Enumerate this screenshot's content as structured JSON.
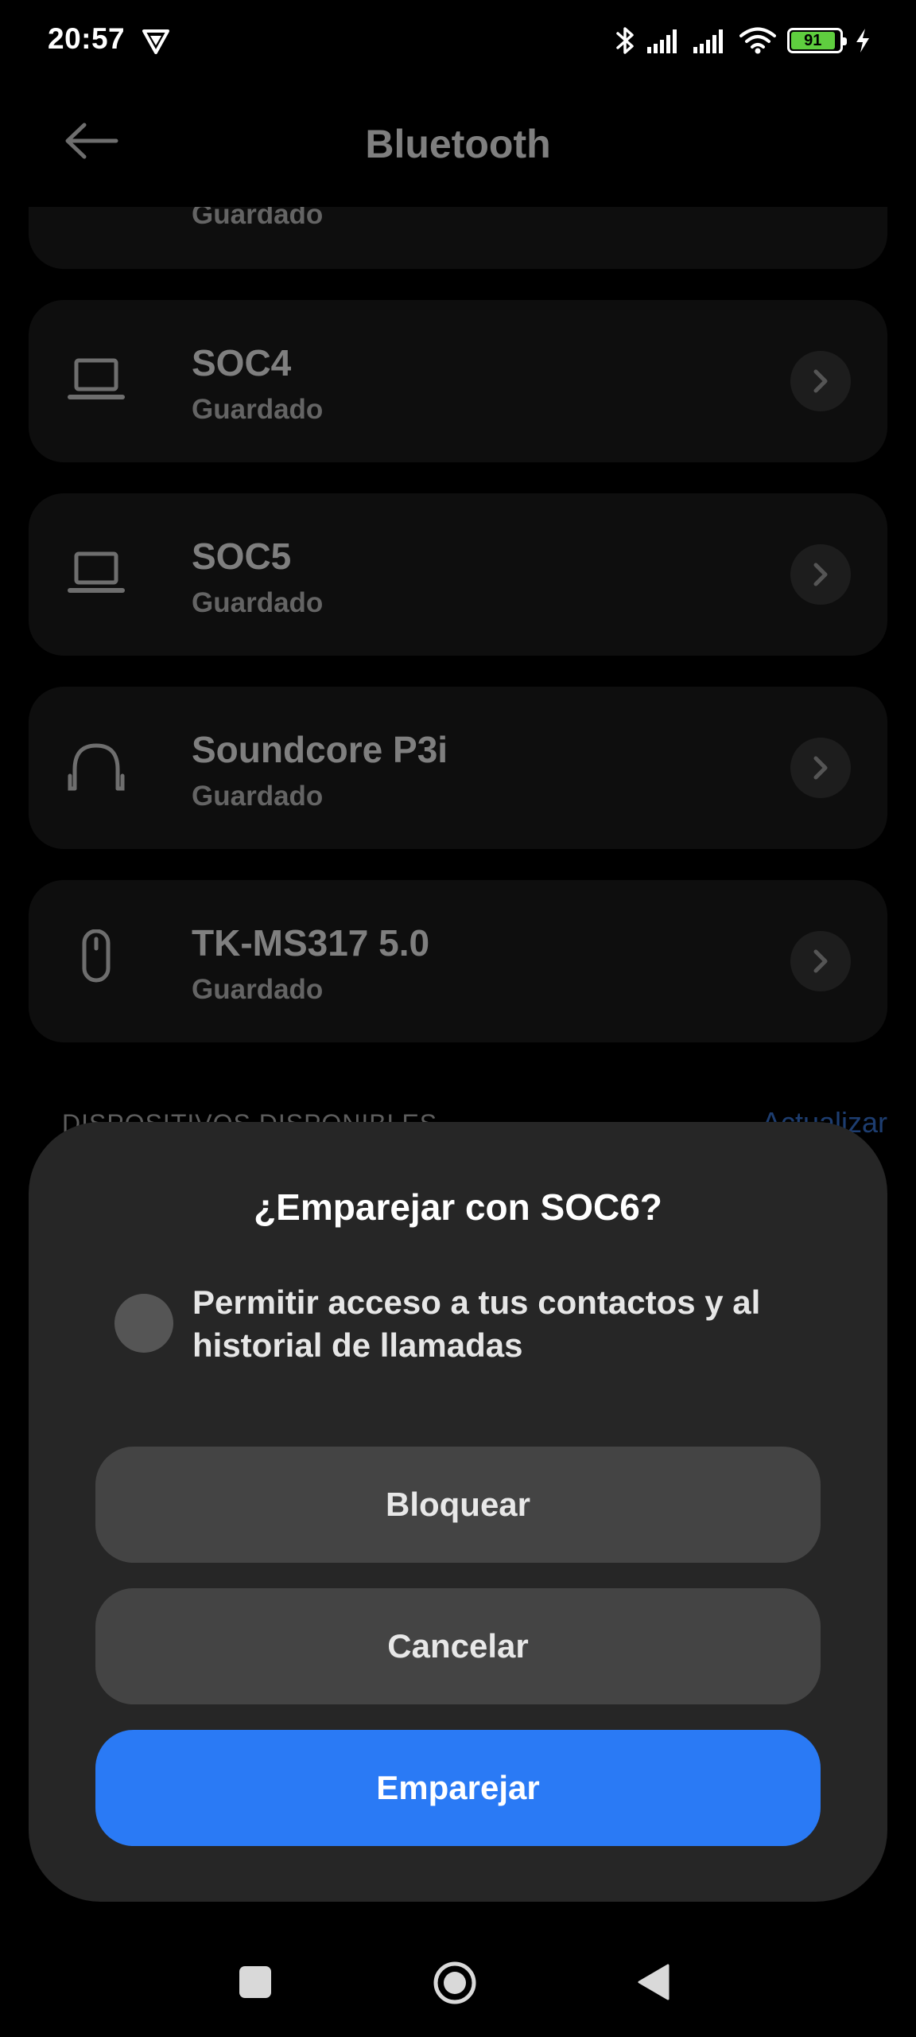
{
  "status_bar": {
    "time": "20:57",
    "battery_level": "91",
    "icons": [
      "vpn-icon",
      "bluetooth-icon",
      "signal-icon",
      "signal-icon",
      "wifi-icon",
      "battery-icon",
      "charging-icon"
    ]
  },
  "header": {
    "title": "Bluetooth",
    "back_icon": "arrow-left-icon"
  },
  "devices": [
    {
      "name": "",
      "status": "Guardado",
      "icon": "laptop-icon"
    },
    {
      "name": "SOC4",
      "status": "Guardado",
      "icon": "laptop-icon"
    },
    {
      "name": "SOC5",
      "status": "Guardado",
      "icon": "laptop-icon"
    },
    {
      "name": "Soundcore P3i",
      "status": "Guardado",
      "icon": "headphones-icon"
    },
    {
      "name": "TK-MS317 5.0",
      "status": "Guardado",
      "icon": "mouse-icon"
    }
  ],
  "available_section": {
    "label": "DISPOSITIVOS DISPONIBLES",
    "refresh_label": "Actualizar"
  },
  "dialog": {
    "title": "¿Emparejar con SOC6?",
    "option_text": "Permitir acceso a tus contactos y al historial de llamadas",
    "option_checked": false,
    "block_label": "Bloquear",
    "cancel_label": "Cancelar",
    "pair_label": "Emparejar"
  },
  "colors": {
    "accent": "#2a7af5",
    "card": "#1d1d1d",
    "dialog": "#262626"
  }
}
